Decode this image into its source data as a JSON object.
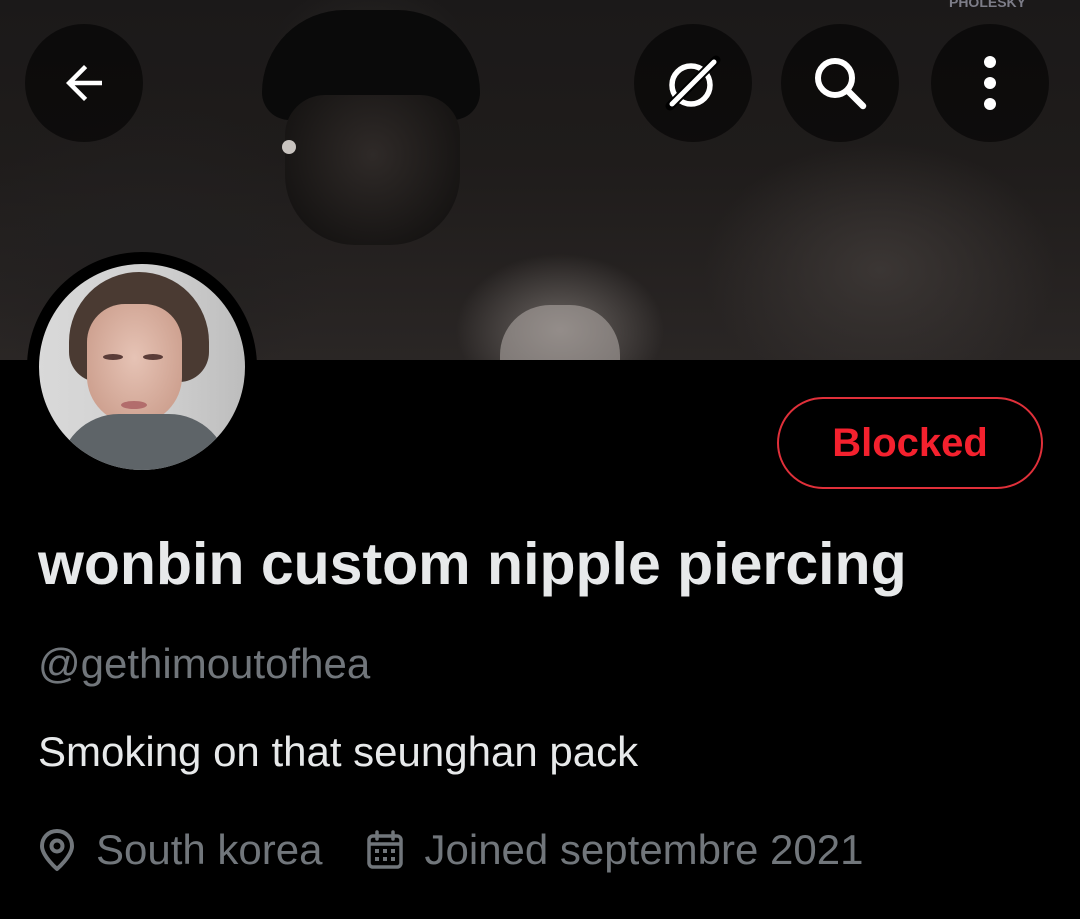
{
  "banner": {
    "watermark": "PHOLESKY"
  },
  "nav": {
    "back_icon": "arrow-left-icon",
    "grok_icon": "grok-slash-circle-icon",
    "search_icon": "search-icon",
    "more_icon": "vertical-ellipsis-icon"
  },
  "profile": {
    "display_name": "wonbin custom nipple piercing",
    "handle": "@gethimoutofhea",
    "bio": "Smoking on that seunghan pack",
    "location": "South korea",
    "joined": "Joined septembre 2021",
    "location_icon": "location-pin-icon",
    "calendar_icon": "calendar-icon"
  },
  "actions": {
    "blocked_label": "Blocked"
  },
  "colors": {
    "background": "#000000",
    "text_primary": "#e7e9ea",
    "text_secondary": "#71767b",
    "blocked_red": "#f4212e"
  }
}
